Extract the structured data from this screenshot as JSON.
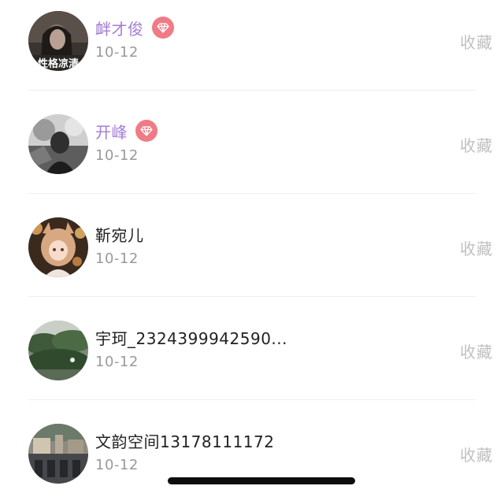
{
  "colors": {
    "vip_name": "#a57dd6",
    "normal_name": "#222222",
    "date": "#9a9a9a",
    "action": "#c0c0c0",
    "badge_bg": "#ef7b86"
  },
  "users": [
    {
      "name": "衅才俊",
      "vip": true,
      "date": "10-12",
      "action": "收藏",
      "avatar_icon": "avatar-photo-woman-dark",
      "avatar_caption": "性格凉清"
    },
    {
      "name": "开峰",
      "vip": true,
      "date": "10-12",
      "action": "收藏",
      "avatar_icon": "avatar-photo-bw-portrait"
    },
    {
      "name": "靳宛儿",
      "vip": false,
      "date": "10-12",
      "action": "收藏",
      "avatar_icon": "avatar-photo-anime-girl"
    },
    {
      "name": "宇珂_2324399942590...",
      "vip": false,
      "date": "10-12",
      "action": "收藏",
      "avatar_icon": "avatar-photo-green-trees"
    },
    {
      "name": "文韵空间13178111172",
      "vip": false,
      "date": "10-12",
      "action": "收藏",
      "avatar_icon": "avatar-photo-outdoor-scene"
    }
  ],
  "badge_icon": "diamond-icon"
}
